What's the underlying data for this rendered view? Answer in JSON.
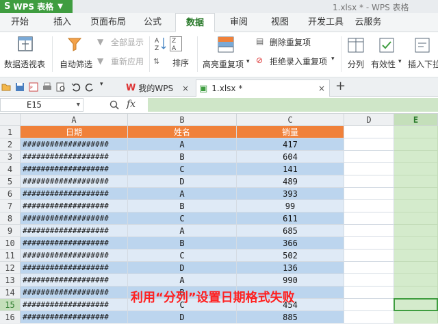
{
  "titlebar": {
    "app_name": "WPS 表格",
    "doc_title": "1.xlsx * - WPS 表格"
  },
  "menu": {
    "tabs": [
      "开始",
      "插入",
      "页面布局",
      "公式",
      "数据",
      "审阅",
      "视图",
      "开发工具",
      "云服务"
    ],
    "active_index": 4
  },
  "ribbon": {
    "pivot": "数据透视表",
    "autofilter": "自动筛选",
    "show_all": "全部显示",
    "reapply": "重新应用",
    "sort": "排序",
    "highlight_dup": "高亮重复项",
    "delete_dup": "删除重复项",
    "reject_dup": "拒绝录入重复项",
    "split": "分列",
    "validity": "有效性",
    "insert_dropdown": "插入下拉"
  },
  "doc_tabs": {
    "home_tab": "我的WPS",
    "file_tab": "1.xlsx *",
    "add": "+"
  },
  "formula_bar": {
    "cell_ref": "E15",
    "fx": "fx"
  },
  "grid": {
    "columns": [
      "A",
      "B",
      "C",
      "D",
      "E"
    ],
    "selected_column": "E",
    "selected_row": 15,
    "header_row": [
      "日期",
      "姓名",
      "销量"
    ],
    "hash_text": "###################",
    "rows": [
      {
        "row": 2,
        "name": "A",
        "sales": "417"
      },
      {
        "row": 3,
        "name": "B",
        "sales": "604"
      },
      {
        "row": 4,
        "name": "C",
        "sales": "141"
      },
      {
        "row": 5,
        "name": "D",
        "sales": "489"
      },
      {
        "row": 6,
        "name": "A",
        "sales": "393"
      },
      {
        "row": 7,
        "name": "B",
        "sales": "99"
      },
      {
        "row": 8,
        "name": "C",
        "sales": "611"
      },
      {
        "row": 9,
        "name": "A",
        "sales": "685"
      },
      {
        "row": 10,
        "name": "B",
        "sales": "366"
      },
      {
        "row": 11,
        "name": "C",
        "sales": "502"
      },
      {
        "row": 12,
        "name": "D",
        "sales": "136"
      },
      {
        "row": 13,
        "name": "A",
        "sales": "990"
      },
      {
        "row": 14,
        "name": "B",
        "sales": ""
      },
      {
        "row": 15,
        "name": "C",
        "sales": "454"
      },
      {
        "row": 16,
        "name": "D",
        "sales": "885"
      }
    ]
  },
  "overlay_caption": "利用“分列”设置日期格式失败",
  "colors": {
    "app_green": "#3f9d40",
    "header_orange": "#f0813a",
    "row_blue": "#bcd5ee",
    "row_light": "#dfeaf6",
    "selection_green": "#d4ebcc",
    "caption_red": "#ff2020"
  }
}
